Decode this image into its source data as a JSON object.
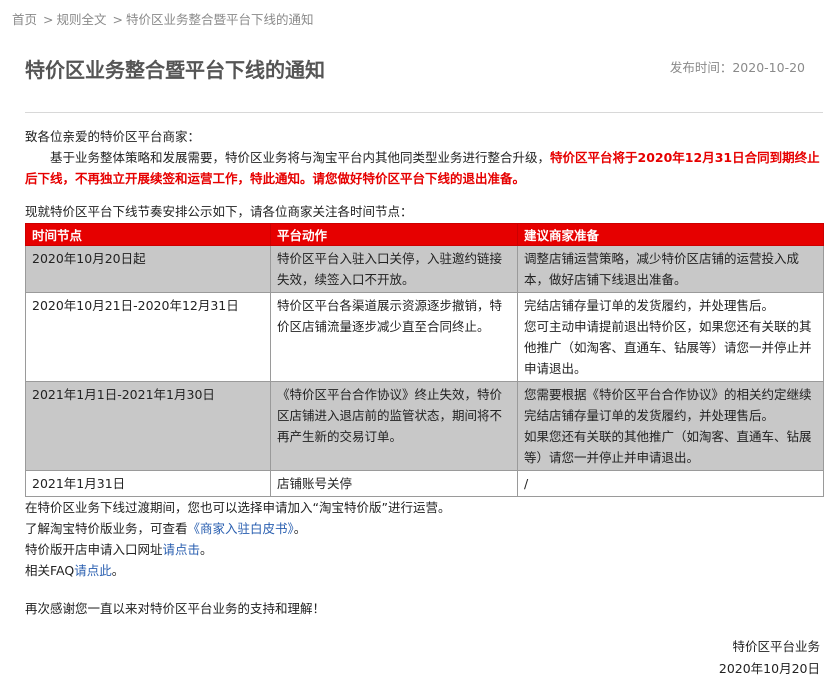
{
  "breadcrumb": {
    "home": "首页",
    "rules": "规则全文",
    "current": "特价区业务整合暨平台下线的通知",
    "separator": ">"
  },
  "header": {
    "title": "特价区业务整合暨平台下线的通知",
    "publish_label": "发布时间：",
    "publish_date": "2020-10-20"
  },
  "body": {
    "greeting": "致各位亲爱的特价区平台商家：",
    "intro_normal": "基于业务整体策略和发展需要，特价区业务将与淘宝平台内其他同类型业务进行整合升级，",
    "intro_red": "特价区平台将于2020年12月31日合同到期终止后下线，不再独立开展续签和运营工作，特此通知。请您做好特价区平台下线的退出准备。",
    "schedule_intro": "现就特价区平台下线节奏安排公示如下，请各位商家关注各时间节点："
  },
  "table": {
    "headers": [
      "时间节点",
      "平台动作",
      "建议商家准备"
    ],
    "rows": [
      {
        "time": "2020年10月20日起",
        "action": [
          "特价区平台入驻入口关停，入驻邀约链接失效，续签入口不开放。"
        ],
        "prep": [
          "调整店铺运营策略，减少特价区店铺的运营投入成本，做好店铺下线退出准备。"
        ]
      },
      {
        "time": "2020年10月21日-2020年12月31日",
        "action": [
          "特价区平台各渠道展示资源逐步撤销，特价区店铺流量逐步减少直至合同终止。"
        ],
        "prep": [
          "完结店铺存量订单的发货履约，并处理售后。",
          "您可主动申请提前退出特价区，如果您还有关联的其他推广（如淘客、直通车、钻展等）请您一并停止并申请退出。"
        ]
      },
      {
        "time": "2021年1月1日-2021年1月30日",
        "action": [
          "《特价区平台合作协议》终止失效，特价区店铺进入退店前的监管状态，期间将不再产生新的交易订单。"
        ],
        "prep": [
          "您需要根据《特价区平台合作协议》的相关约定继续完结店铺存量订单的发货履约，并处理售后。",
          "如果您还有关联的其他推广（如淘客、直通车、钻展等）请您一并停止并申请退出。"
        ]
      },
      {
        "time": "2021年1月31日",
        "action": [
          "店铺账号关停"
        ],
        "prep": [
          "/"
        ]
      }
    ]
  },
  "footer_lines": {
    "transition": "在特价区业务下线过渡期间，您也可以选择申请加入“淘宝特价版”进行运营。",
    "learn_prefix": "了解淘宝特价版业务，可查看",
    "learn_link": "《商家入驻白皮书》",
    "learn_suffix": "。",
    "apply_prefix": "特价版开店申请入口网址",
    "apply_link": "请点击",
    "apply_suffix": "。",
    "faq_prefix": "相关FAQ",
    "faq_link": "请点此",
    "faq_suffix": "。",
    "thanks": "再次感谢您一直以来对特价区平台业务的支持和理解！"
  },
  "signature": {
    "org": "特价区平台业务",
    "date": "2020年10月20日"
  },
  "colors": {
    "accent_red": "#e60000",
    "row_gray": "#c8c8c8",
    "link_blue": "#2a5fb0"
  }
}
